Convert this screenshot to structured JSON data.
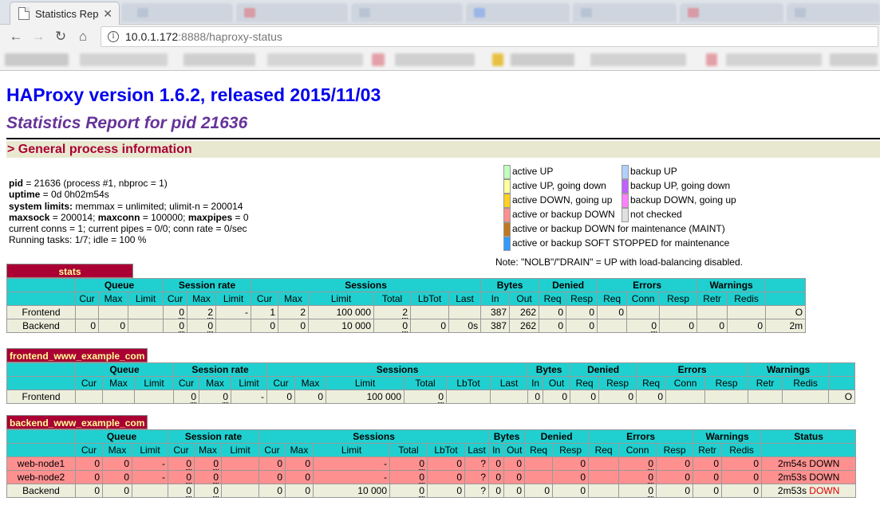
{
  "browser": {
    "tab_title": "Statistics Rep",
    "url_host": "10.0.1.172",
    "url_rest": ":8888/haproxy-status"
  },
  "page": {
    "title": "HAProxy version 1.6.2, released 2015/11/03",
    "subtitle": "Statistics Report for pid 21636",
    "section": "> General process information"
  },
  "procinfo": {
    "pid_label": "pid",
    "pid_value": " = 21636 (process #1, nbproc = 1)",
    "uptime_label": "uptime",
    "uptime_value": " = 0d 0h02m54s",
    "limits_label": "system limits:",
    "limits_value": " memmax = unlimited; ulimit-n = 200014",
    "maxsock_label": "maxsock",
    "maxsock_value": " = 200014; ",
    "maxconn_label": "maxconn",
    "maxconn_value": " = 100000; ",
    "maxpipes_label": "maxpipes",
    "maxpipes_value": " = 0",
    "conns": "current conns = 1; current pipes = 0/0; conn rate = 0/sec",
    "tasks": "Running tasks: 1/7; idle = 100 %"
  },
  "legend": {
    "active_up": "active UP",
    "active_up_going_down": "active UP, going down",
    "active_down_going_up": "active DOWN, going up",
    "active_or_backup_down": "active or backup DOWN",
    "maint": "active or backup DOWN for maintenance (MAINT)",
    "soft_stopped": "active or backup SOFT STOPPED for maintenance",
    "backup_up": "backup UP",
    "backup_up_going_down": "backup UP, going down",
    "backup_down_going_up": "backup DOWN, going up",
    "not_checked": "not checked",
    "note": "Note: \"NOLB\"/\"DRAIN\" = UP with load-balancing disabled.",
    "colors": {
      "active_up": "#c0ffc0",
      "active_up_going_down": "#ffffa0",
      "active_down_going_up": "#ffd020",
      "active_or_backup_down": "#ff9090",
      "maint": "#c07820",
      "soft_stopped": "#3399ff",
      "backup_up": "#b0d0ff",
      "backup_up_going_down": "#c060ff",
      "backup_down_going_up": "#ff80ff",
      "not_checked": "#e0e0e0"
    }
  },
  "headers": {
    "queue": "Queue",
    "session_rate": "Session rate",
    "sessions": "Sessions",
    "bytes": "Bytes",
    "denied": "Denied",
    "errors": "Errors",
    "warnings": "Warnings",
    "status": "Status",
    "status_trunc": "S",
    "cur": "Cur",
    "max": "Max",
    "limit": "Limit",
    "total": "Total",
    "lbtot": "LbTot",
    "last": "Last",
    "in": "In",
    "out": "Out",
    "req": "Req",
    "resp": "Resp",
    "conn": "Conn",
    "retr": "Retr",
    "redis": "Redis"
  },
  "stats": {
    "name": "stats",
    "frontend": [
      "Frontend",
      "",
      "",
      "",
      "0",
      "2",
      "-",
      "1",
      "2",
      "100 000",
      "2",
      "",
      "",
      "387",
      "262",
      "0",
      "0",
      "0",
      "",
      "",
      "",
      "",
      "O"
    ],
    "backend": [
      "Backend",
      "0",
      "0",
      "",
      "0",
      "0",
      "",
      "0",
      "0",
      "10 000",
      "0",
      "0",
      "0s",
      "387",
      "262",
      "0",
      "0",
      "",
      "0",
      "0",
      "0",
      "0",
      "2m"
    ]
  },
  "frontend_www": {
    "name": "frontend_www_example_com",
    "frontend": [
      "Frontend",
      "",
      "",
      "",
      "0",
      "0",
      "-",
      "0",
      "0",
      "100 000",
      "0",
      "",
      "",
      "0",
      "0",
      "0",
      "0",
      "0",
      "",
      "",
      "",
      "",
      "O"
    ]
  },
  "backend_www": {
    "name": "backend_www_example_com",
    "node1": [
      "web-node1",
      "0",
      "0",
      "-",
      "0",
      "0",
      "",
      "0",
      "0",
      "-",
      "0",
      "0",
      "?",
      "0",
      "0",
      "",
      "0",
      "",
      "0",
      "0",
      "0",
      "0",
      "2m54s DOWN"
    ],
    "node2": [
      "web-node2",
      "0",
      "0",
      "-",
      "0",
      "0",
      "",
      "0",
      "0",
      "-",
      "0",
      "0",
      "?",
      "0",
      "0",
      "",
      "0",
      "",
      "0",
      "0",
      "0",
      "0",
      "2m53s DOWN"
    ],
    "backend": [
      "Backend",
      "0",
      "0",
      "",
      "0",
      "0",
      "",
      "0",
      "0",
      "10 000",
      "0",
      "0",
      "?",
      "0",
      "0",
      "0",
      "0",
      "",
      "0",
      "0",
      "0",
      "0",
      "2m53s"
    ],
    "backend_status_down": "DOWN"
  }
}
